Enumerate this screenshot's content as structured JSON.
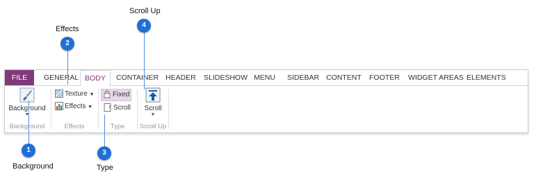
{
  "tabs": [
    "FILE",
    "GENERAL",
    "BODY",
    "CONTAINER",
    "HEADER",
    "SLIDESHOW",
    "MENU",
    "SIDEBAR",
    "CONTENT",
    "FOOTER",
    "WIDGET AREAS",
    "ELEMENTS"
  ],
  "active_tab": "BODY",
  "groups": {
    "background": {
      "label": "Background",
      "button": "Background"
    },
    "effects": {
      "label": "Effects",
      "texture": "Texture",
      "effects": "Effects"
    },
    "type": {
      "label": "Type",
      "fixed": "Fixed",
      "scroll": "Scroll"
    },
    "scroll_up": {
      "label": "Scroll Up",
      "button": "Scroll"
    }
  },
  "callouts": [
    {
      "number": "1",
      "label": "Background"
    },
    {
      "number": "2",
      "label": "Effects"
    },
    {
      "number": "3",
      "label": "Type"
    },
    {
      "number": "4",
      "label": "Scroll Up"
    }
  ],
  "colors": {
    "accent": "#80397b",
    "callout": "#1f6fd6",
    "selected_bg": "#e9d6ea"
  }
}
